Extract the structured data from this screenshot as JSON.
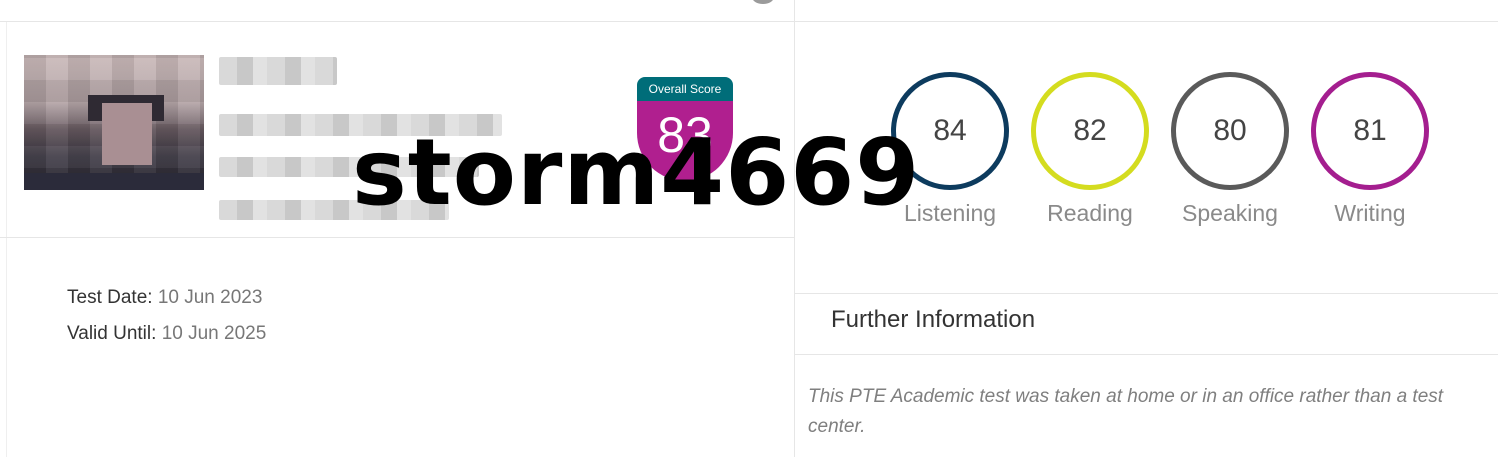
{
  "profile": {
    "avatar_alt": "profile photo (pixelated)",
    "overall_score_label": "Overall Score",
    "overall_score": "83"
  },
  "watermark": "storm4669",
  "dates": {
    "test_date_label": "Test Date:",
    "test_date_value": "10 Jun 2023",
    "valid_until_label": "Valid Until:",
    "valid_until_value": "10 Jun 2025"
  },
  "skills": [
    {
      "score": "84",
      "label": "Listening",
      "color": "#0d3b5e"
    },
    {
      "score": "82",
      "label": "Reading",
      "color": "#d4dc1f"
    },
    {
      "score": "80",
      "label": "Speaking",
      "color": "#5a5a5a"
    },
    {
      "score": "81",
      "label": "Writing",
      "color": "#a41e8f"
    }
  ],
  "further": {
    "title": "Further Information",
    "text": "This PTE Academic test was taken at home or in an office rather than a test center."
  },
  "colors": {
    "badge_header": "#006d79",
    "badge_body": "#b01f8f"
  }
}
